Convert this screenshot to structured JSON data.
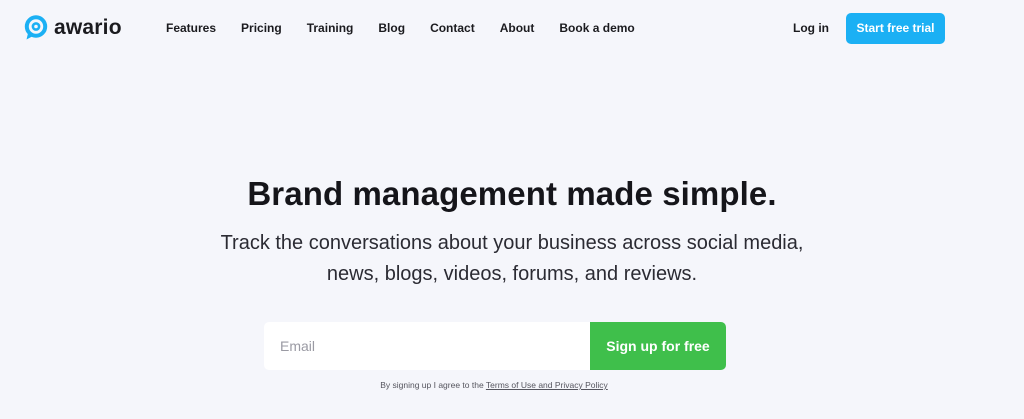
{
  "header": {
    "brand": "awario",
    "logo_icon": "awario-chat-bubble-icon",
    "nav": [
      {
        "label": "Features"
      },
      {
        "label": "Pricing"
      },
      {
        "label": "Training"
      },
      {
        "label": "Blog"
      },
      {
        "label": "Contact"
      },
      {
        "label": "About"
      },
      {
        "label": "Book a demo"
      }
    ],
    "login_label": "Log in",
    "trial_label": "Start free trial"
  },
  "hero": {
    "title": "Brand management made simple.",
    "subtitle_line1": "Track the conversations about your business across social media,",
    "subtitle_line2": "news, blogs, videos, forums, and reviews."
  },
  "signup": {
    "email_placeholder": "Email",
    "email_value": "",
    "button_label": "Sign up for free",
    "terms_prefix": "By signing up I agree to the ",
    "terms_link": "Terms of Use and Privacy Policy"
  },
  "colors": {
    "background": "#f5f6fb",
    "accent_blue": "#1bb0f4",
    "accent_green": "#3fbf4b",
    "text_dark": "#15151a"
  }
}
